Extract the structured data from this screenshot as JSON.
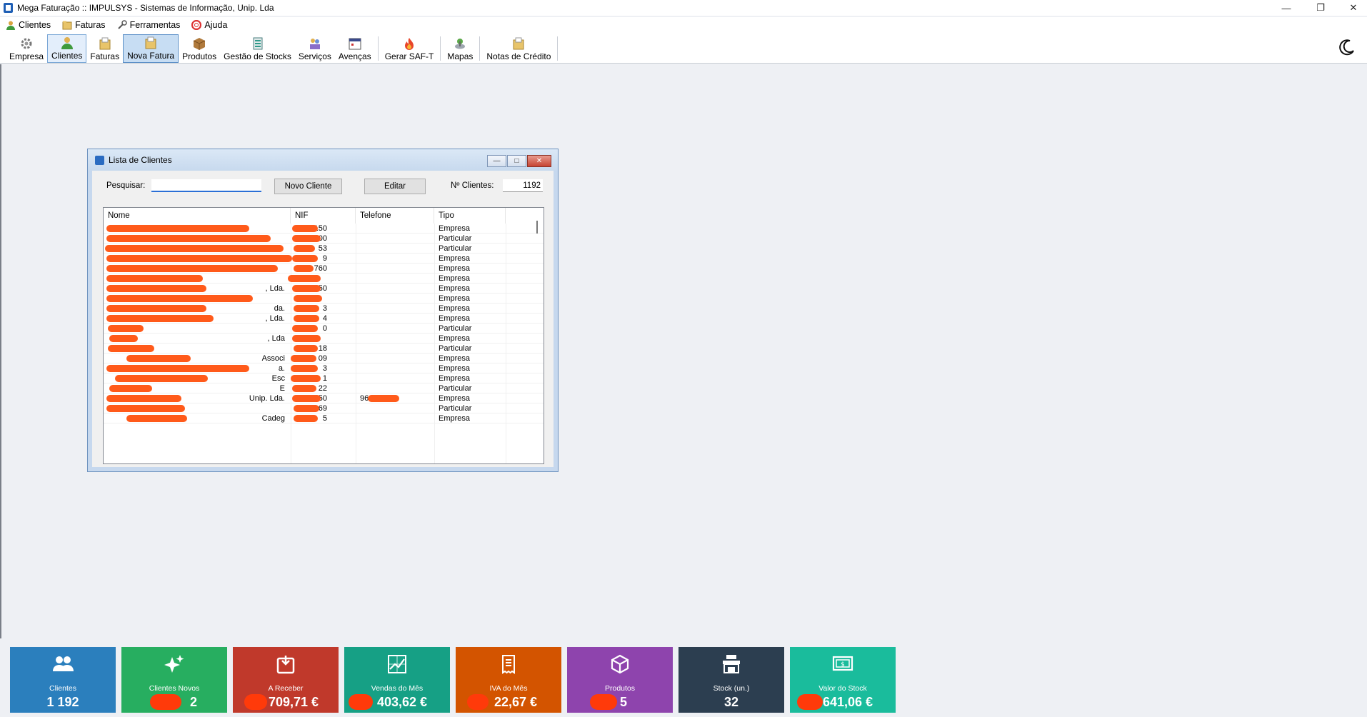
{
  "window": {
    "title": "Mega Faturação :: IMPULSYS - Sistemas de Informação, Unip. Lda"
  },
  "menu": [
    {
      "label": "Clientes",
      "icon": "user-icon"
    },
    {
      "label": "Faturas",
      "icon": "folder-icon"
    },
    {
      "label": "Ferramentas",
      "icon": "tools-icon"
    },
    {
      "label": "Ajuda",
      "icon": "help-icon"
    }
  ],
  "toolbar": [
    {
      "label": "Empresa",
      "icon": "gear-icon"
    },
    {
      "label": "Clientes",
      "icon": "user-icon"
    },
    {
      "label": "Faturas",
      "icon": "folder-icon"
    },
    {
      "label": "Nova Fatura",
      "icon": "new-invoice-icon"
    },
    {
      "label": "Produtos",
      "icon": "box-icon"
    },
    {
      "label": "Gestão de Stocks",
      "icon": "stock-icon"
    },
    {
      "label": "Serviços",
      "icon": "services-icon"
    },
    {
      "label": "Avenças",
      "icon": "calendar-icon"
    },
    {
      "label": "Gerar SAF-T",
      "icon": "fire-icon"
    },
    {
      "label": "Mapas",
      "icon": "map-icon"
    },
    {
      "label": "Notas de Crédito",
      "icon": "credit-note-icon"
    }
  ],
  "clients_window": {
    "title": "Lista de Clientes",
    "search_label": "Pesquisar:",
    "search_value": "",
    "new_button": "Novo Cliente",
    "edit_button": "Editar",
    "count_label": "Nº Clientes:",
    "count_value": "1192",
    "columns": [
      "Nome",
      "NIF",
      "Telefone",
      "Tipo"
    ],
    "rows": [
      {
        "nome": "",
        "nif": "371150",
        "tel": "",
        "tipo": "Empresa"
      },
      {
        "nome": "",
        "nif": "09100",
        "tel": "",
        "tipo": "Particular"
      },
      {
        "nome": "",
        "nif": "53",
        "tel": "",
        "tipo": "Particular"
      },
      {
        "nome": "",
        "nif": "9",
        "tel": "",
        "tipo": "Empresa"
      },
      {
        "nome": "",
        "nif": "760",
        "tel": "",
        "tipo": "Empresa"
      },
      {
        "nome": "",
        "nif": "",
        "tel": "",
        "tipo": "Empresa"
      },
      {
        "nome": ", Lda.",
        "nif": "50",
        "tel": "",
        "tipo": "Empresa"
      },
      {
        "nome": "",
        "nif": "",
        "tel": "",
        "tipo": "Empresa"
      },
      {
        "nome": "da.",
        "nif": "3",
        "tel": "",
        "tipo": "Empresa"
      },
      {
        "nome": ", Lda.",
        "nif": "4",
        "tel": "",
        "tipo": "Empresa"
      },
      {
        "nome": "",
        "nif": "0",
        "tel": "",
        "tipo": "Particular"
      },
      {
        "nome": ", Lda",
        "nif": "",
        "tel": "",
        "tipo": "Empresa"
      },
      {
        "nome": "",
        "nif": "18",
        "tel": "",
        "tipo": "Particular"
      },
      {
        "nome": "Associ",
        "nif": "09",
        "tel": "",
        "tipo": "Empresa"
      },
      {
        "nome": "a.",
        "nif": "3",
        "tel": "",
        "tipo": "Empresa"
      },
      {
        "nome": "Esc",
        "nif": "1",
        "tel": "",
        "tipo": "Empresa"
      },
      {
        "nome": "E",
        "nif": "22",
        "tel": "",
        "tipo": "Particular"
      },
      {
        "nome": "Unip. Lda.",
        "nif": "50",
        "tel": "96",
        "tipo": "Empresa"
      },
      {
        "nome": "",
        "nif": "69",
        "tel": "",
        "tipo": "Particular"
      },
      {
        "nome": "Cadeg",
        "nif": "5",
        "tel": "",
        "tipo": "Empresa"
      }
    ]
  },
  "dashboard": [
    {
      "label": "Clientes",
      "value": "1 192",
      "color": "#2b7fbd",
      "icon": "users-icon"
    },
    {
      "label": "Clientes Novos",
      "value": "2",
      "color": "#27ae60",
      "icon": "sparkle-icon"
    },
    {
      "label": "A Receber",
      "value": "709,71 €",
      "color": "#c0392b",
      "icon": "inbox-icon"
    },
    {
      "label": "Vendas do Mês",
      "value": "403,62 €",
      "color": "#16a085",
      "icon": "chart-icon"
    },
    {
      "label": "IVA do Mês",
      "value": "22,67 €",
      "color": "#d35400",
      "icon": "receipt-icon"
    },
    {
      "label": "Produtos",
      "value": "5",
      "color": "#8e44ad",
      "icon": "cube-icon"
    },
    {
      "label": "Stock (un.)",
      "value": "32",
      "color": "#2c3e50",
      "icon": "store-icon"
    },
    {
      "label": "Valor do Stock",
      "value": "641,06 €",
      "color": "#1abc9c",
      "icon": "money-icon"
    }
  ]
}
